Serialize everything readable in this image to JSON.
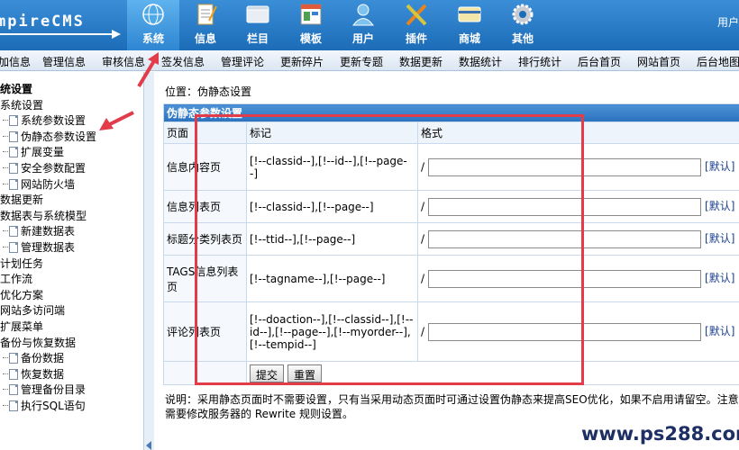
{
  "brand": {
    "logo_text": "mpireCMS"
  },
  "top_nav": [
    {
      "label": "系统",
      "icon": "globe-icon",
      "active": true
    },
    {
      "label": "信息",
      "icon": "document-icon"
    },
    {
      "label": "栏目",
      "icon": "folder-icon"
    },
    {
      "label": "模板",
      "icon": "template-icon"
    },
    {
      "label": "用户",
      "icon": "user-icon"
    },
    {
      "label": "插件",
      "icon": "plugin-icon"
    },
    {
      "label": "商城",
      "icon": "card-icon"
    },
    {
      "label": "其他",
      "icon": "gear-icon"
    }
  ],
  "user_label": "用户",
  "sub_nav": [
    "加信息",
    "管理信息",
    "审核信息",
    "签发信息",
    "管理评论",
    "更新碎片",
    "更新专题",
    "数据更新",
    "数据统计",
    "排行统计",
    "后台首页",
    "网站首页",
    "后台地图"
  ],
  "tree": [
    {
      "label": "统设置",
      "level": 0,
      "bold": true
    },
    {
      "label": "系统设置",
      "level": 0
    },
    {
      "label": "系统参数设置",
      "level": 1,
      "doc": true
    },
    {
      "label": "伪静态参数设置",
      "level": 1,
      "doc": true
    },
    {
      "label": "扩展变量",
      "level": 1,
      "doc": true
    },
    {
      "label": "安全参数配置",
      "level": 1,
      "doc": true
    },
    {
      "label": "网站防火墙",
      "level": 1,
      "doc": true
    },
    {
      "label": "数据更新",
      "level": 0
    },
    {
      "label": "数据表与系统模型",
      "level": 0
    },
    {
      "label": "新建数据表",
      "level": 1,
      "doc": true
    },
    {
      "label": "管理数据表",
      "level": 1,
      "doc": true
    },
    {
      "label": "计划任务",
      "level": 0
    },
    {
      "label": "工作流",
      "level": 0
    },
    {
      "label": "优化方案",
      "level": 0
    },
    {
      "label": "网站多访问端",
      "level": 0
    },
    {
      "label": "扩展菜单",
      "level": 0
    },
    {
      "label": "备份与恢复数据",
      "level": 0
    },
    {
      "label": "备份数据",
      "level": 1,
      "doc": true
    },
    {
      "label": "恢复数据",
      "level": 1,
      "doc": true
    },
    {
      "label": "管理备份目录",
      "level": 1,
      "doc": true
    },
    {
      "label": "执行SQL语句",
      "level": 1,
      "doc": true
    }
  ],
  "main": {
    "location": "位置：伪静态设置",
    "table_title": "伪静态参数设置",
    "headers": {
      "page": "页面",
      "tag": "标记",
      "format": "格式"
    },
    "rows": [
      {
        "page": "信息内容页",
        "tag": "[!--classid--],[!--id--],[!--page--]",
        "prefix": "/",
        "value": "",
        "default_label": "[默认]"
      },
      {
        "page": "信息列表页",
        "tag": "[!--classid--],[!--page--]",
        "prefix": "/",
        "value": "",
        "default_label": "[默认]"
      },
      {
        "page": "标题分类列表页",
        "tag": "[!--ttid--],[!--page--]",
        "prefix": "/",
        "value": "",
        "default_label": "[默认]"
      },
      {
        "page": "TAGS信息列表页",
        "tag": "[!--tagname--],[!--page--]",
        "prefix": "/",
        "value": "",
        "default_label": "[默认]"
      },
      {
        "page": "评论列表页",
        "tag": "[!--doaction--],[!--classid--],[!--id--],[!--page--],[!--myorder--],[!--tempid--]",
        "prefix": "/",
        "value": "",
        "default_label": "[默认]"
      }
    ],
    "submit_label": "提交",
    "reset_label": "重置",
    "note_line1": "说明：采用静态页面时不需要设置，只有当采用动态页面时可通过设置伪静态来提高SEO优化，如果不启用请留空。注意",
    "note_line2": "需要修改服务器的 Rewrite 规则设置。"
  },
  "watermark": "www.ps288.com",
  "colors": {
    "header_blue": "#1c6cb8",
    "annotation_red": "#e23b4a"
  }
}
